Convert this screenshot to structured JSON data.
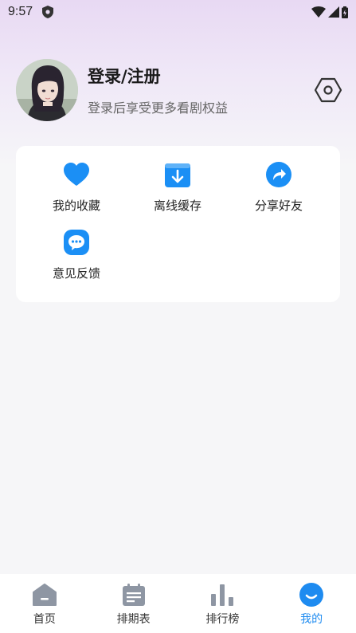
{
  "status_bar": {
    "time": "9:57"
  },
  "profile": {
    "title": "登录/注册",
    "subtitle": "登录后享受更多看剧权益"
  },
  "features": [
    {
      "label": "我的收藏",
      "icon": "heart-icon"
    },
    {
      "label": "离线缓存",
      "icon": "download-icon"
    },
    {
      "label": "分享好友",
      "icon": "share-icon"
    },
    {
      "label": "意见反馈",
      "icon": "chat-icon"
    }
  ],
  "tabs": [
    {
      "label": "首页",
      "icon": "home-icon",
      "active": false
    },
    {
      "label": "排期表",
      "icon": "calendar-icon",
      "active": false
    },
    {
      "label": "排行榜",
      "icon": "bar-chart-icon",
      "active": false
    },
    {
      "label": "我的",
      "icon": "smile-icon",
      "active": true
    }
  ],
  "colors": {
    "accent": "#1e8bf0",
    "icon_blue": "#1b8ff5",
    "tab_inactive": "#8e96a3"
  }
}
